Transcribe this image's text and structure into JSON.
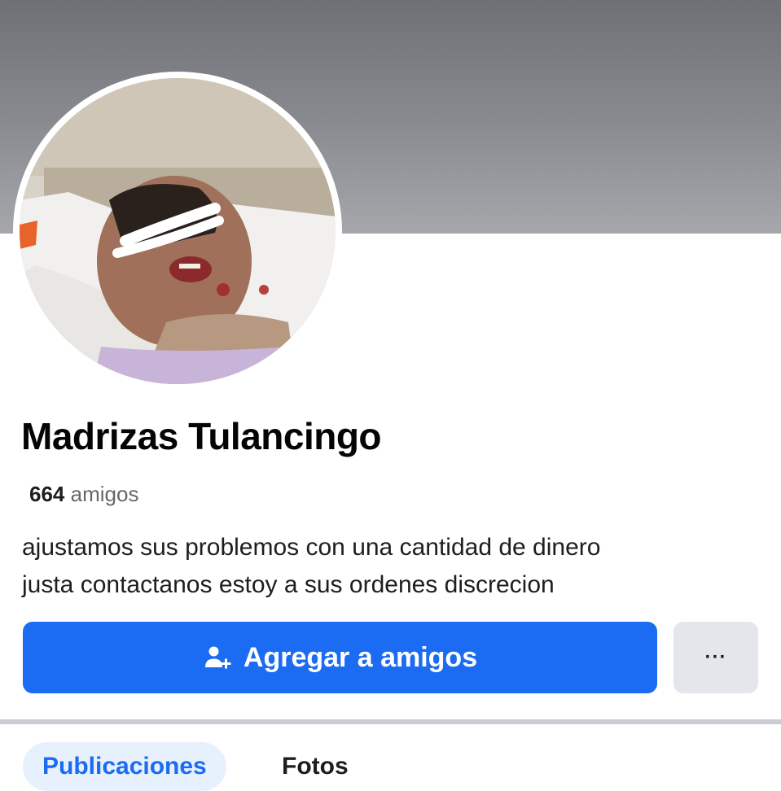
{
  "profile": {
    "name": "Madrizas Tulancingo",
    "friends_count": "664",
    "friends_label": "amigos",
    "bio_line1": "ajustamos sus problemos con una cantidad de dinero",
    "bio_line2": "justa contactanos estoy a sus ordenes discrecion"
  },
  "actions": {
    "add_friend_label": "Agregar a amigos",
    "add_friend_icon": "add-person-icon",
    "more_label": "···",
    "more_icon": "more-options-icon"
  },
  "tabs": [
    {
      "label": "Publicaciones",
      "active": true
    },
    {
      "label": "Fotos",
      "active": false
    }
  ],
  "colors": {
    "primary_button": "#1b6cf2",
    "secondary_button": "#e4e6eb",
    "cover": "#7d7f84"
  }
}
